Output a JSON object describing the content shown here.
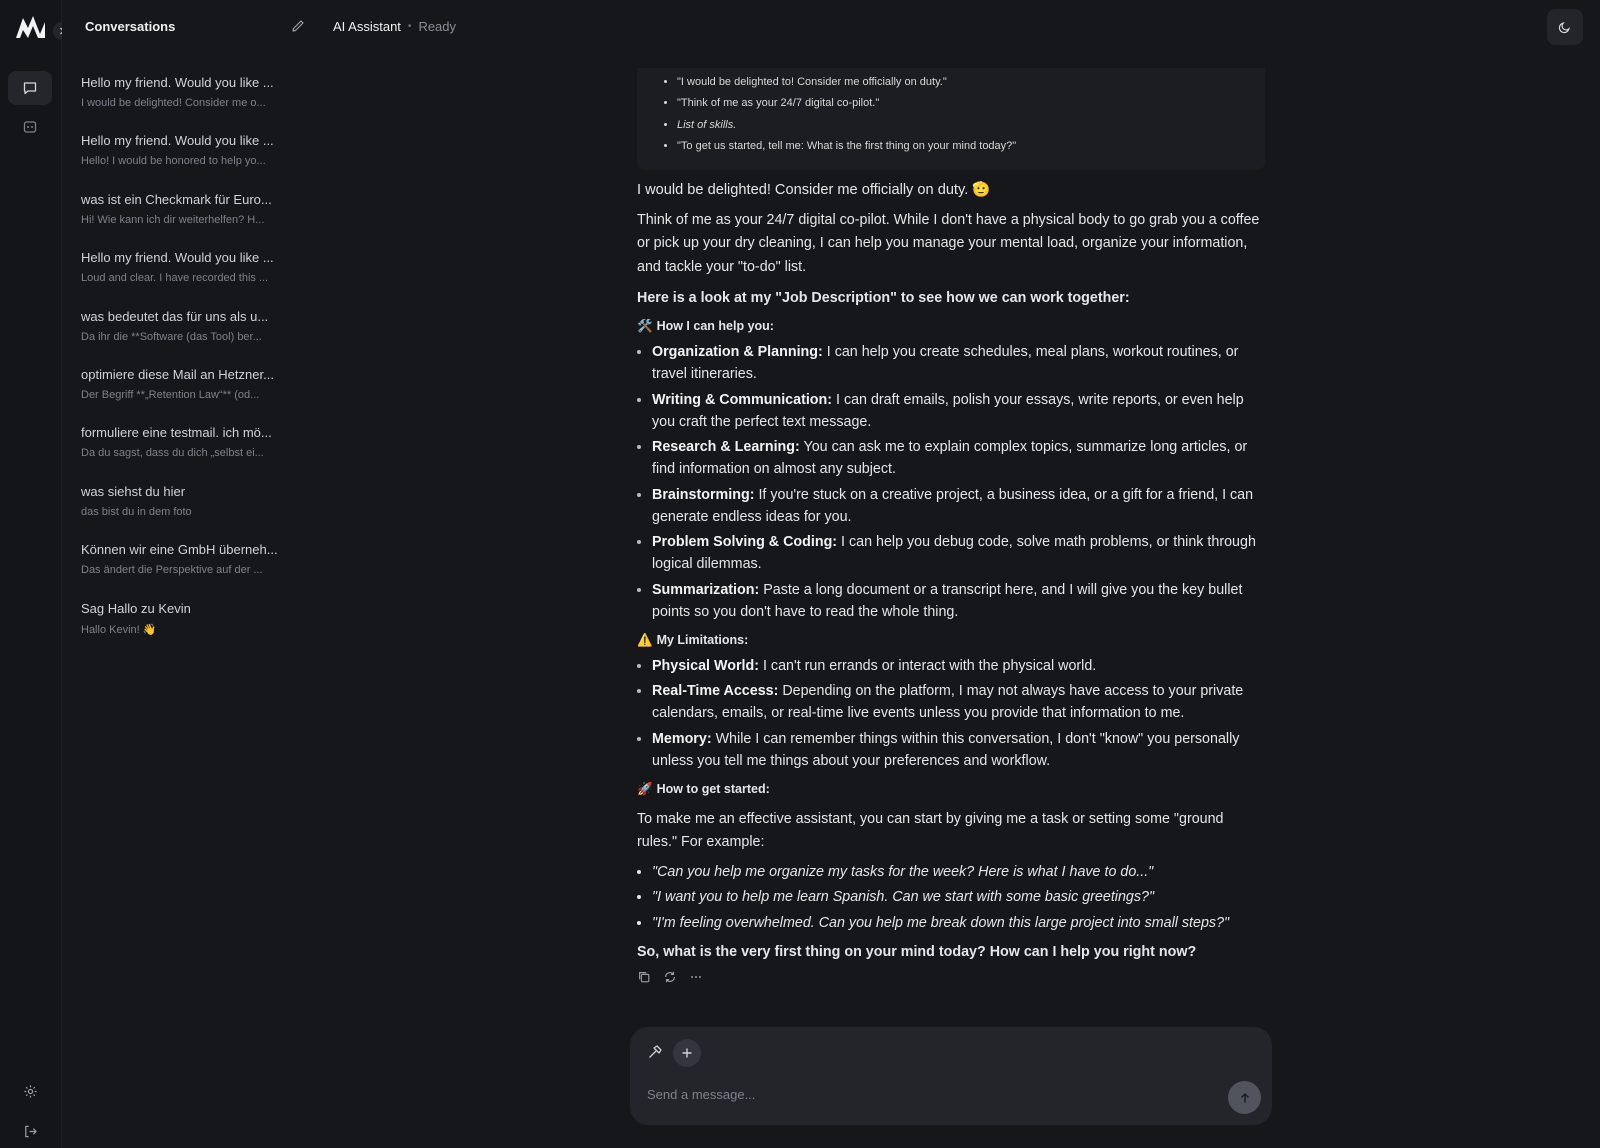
{
  "sidebar": {
    "title": "Conversations",
    "conversations": [
      {
        "title": "Hello my friend. Would you like ...",
        "preview": "I would be delighted! Consider me o..."
      },
      {
        "title": "Hello my friend. Would you like ...",
        "preview": "Hello! I would be honored to help yo..."
      },
      {
        "title": "was ist ein Checkmark für Euro...",
        "preview": "Hi! Wie kann ich dir weiterhelfen? H..."
      },
      {
        "title": "Hello my friend. Would you like ...",
        "preview": "Loud and clear. I have recorded this ..."
      },
      {
        "title": "was bedeutet das für uns als u...",
        "preview": "Da ihr die **Software (das Tool) ber..."
      },
      {
        "title": "optimiere diese Mail an Hetzner...",
        "preview": "Der Begriff **„Retention Law“** (od..."
      },
      {
        "title": "formuliere eine testmail. ich mö...",
        "preview": "Da du sagst, dass du dich „selbst ei..."
      },
      {
        "title": "was siehst du hier",
        "preview": "das bist du in dem foto"
      },
      {
        "title": "Können wir eine GmbH überneh...",
        "preview": "Das ändert die Perspektive auf der ..."
      },
      {
        "title": "Sag Hallo zu Kevin",
        "preview": "Hallo Kevin! 👋"
      }
    ]
  },
  "header": {
    "assistant_name": "AI Assistant",
    "separator": "•",
    "status": "Ready"
  },
  "message": {
    "summary_quotes": [
      "\"I would be delighted to! Consider me officially on duty.\"",
      "\"Think of me as your 24/7 digital co-pilot.\"",
      "List of skills.",
      "\"To get us started, tell me: What is the first thing on your mind today?\""
    ],
    "opening": "I would be delighted! Consider me officially on duty. 🫡",
    "intro": "Think of me as your 24/7 digital co-pilot. While I don't have a physical body to go grab you a coffee or pick up your dry cleaning, I can help you manage your mental load, organize your information, and tackle your \"to-do\" list.",
    "job_heading": "Here is a look at my \"Job Description\" to see how we can work together:",
    "help_heading": {
      "emoji": "🛠️",
      "text": "How I can help you:"
    },
    "help_items": [
      {
        "label": "Organization & Planning:",
        "text": " I can help you create schedules, meal plans, workout routines, or travel itineraries."
      },
      {
        "label": "Writing & Communication:",
        "text": " I can draft emails, polish your essays, write reports, or even help you craft the perfect text message."
      },
      {
        "label": "Research & Learning:",
        "text": " You can ask me to explain complex topics, summarize long articles, or find information on almost any subject."
      },
      {
        "label": "Brainstorming:",
        "text": " If you're stuck on a creative project, a business idea, or a gift for a friend, I can generate endless ideas for you."
      },
      {
        "label": "Problem Solving & Coding:",
        "text": " I can help you debug code, solve math problems, or think through logical dilemmas."
      },
      {
        "label": "Summarization:",
        "text": " Paste a long document or a transcript here, and I will give you the key bullet points so you don't have to read the whole thing."
      }
    ],
    "limits_heading": {
      "emoji": "⚠️",
      "text": "My Limitations:"
    },
    "limit_items": [
      {
        "label": "Physical World:",
        "text": " I can't run errands or interact with the physical world."
      },
      {
        "label": "Real-Time Access:",
        "text": " Depending on the platform, I may not always have access to your private calendars, emails, or real-time live events unless you provide that information to me."
      },
      {
        "label": "Memory:",
        "text": " While I can remember things within this conversation, I don't \"know\" you personally unless you tell me things about your preferences and workflow."
      }
    ],
    "start_heading": {
      "emoji": "🚀",
      "text": "How to get started:"
    },
    "start_intro": "To make me an effective assistant, you can start by giving me a task or setting some \"ground rules.\" For example:",
    "examples": [
      "\"Can you help me organize my tasks for the week? Here is what I have to do...\"",
      "\"I want you to help me learn Spanish. Can we start with some basic greetings?\"",
      "\"I'm feeling overwhelmed. Can you help me break down this large project into small steps?\""
    ],
    "closing": "So, what is the very first thing on your mind today? How can I help you right now?"
  },
  "composer": {
    "placeholder": "Send a message..."
  },
  "icons": {
    "logo": "brand-logo-icon",
    "expand": "chevron-right-icon",
    "chat": "chat-bubble-icon",
    "assistants": "bot-icon",
    "settings": "gear-icon",
    "logout": "logout-icon",
    "edit": "pencil-icon",
    "theme": "moon-icon",
    "copy": "copy-icon",
    "regenerate": "refresh-icon",
    "more": "more-horizontal-icon",
    "tools": "hammer-icon",
    "add": "plus-icon",
    "send": "arrow-up-icon"
  },
  "colors": {
    "background": "#16171b",
    "rail": "#141519",
    "composer": "#23252b",
    "text": "#e6e6e6",
    "muted": "#7e8189"
  }
}
